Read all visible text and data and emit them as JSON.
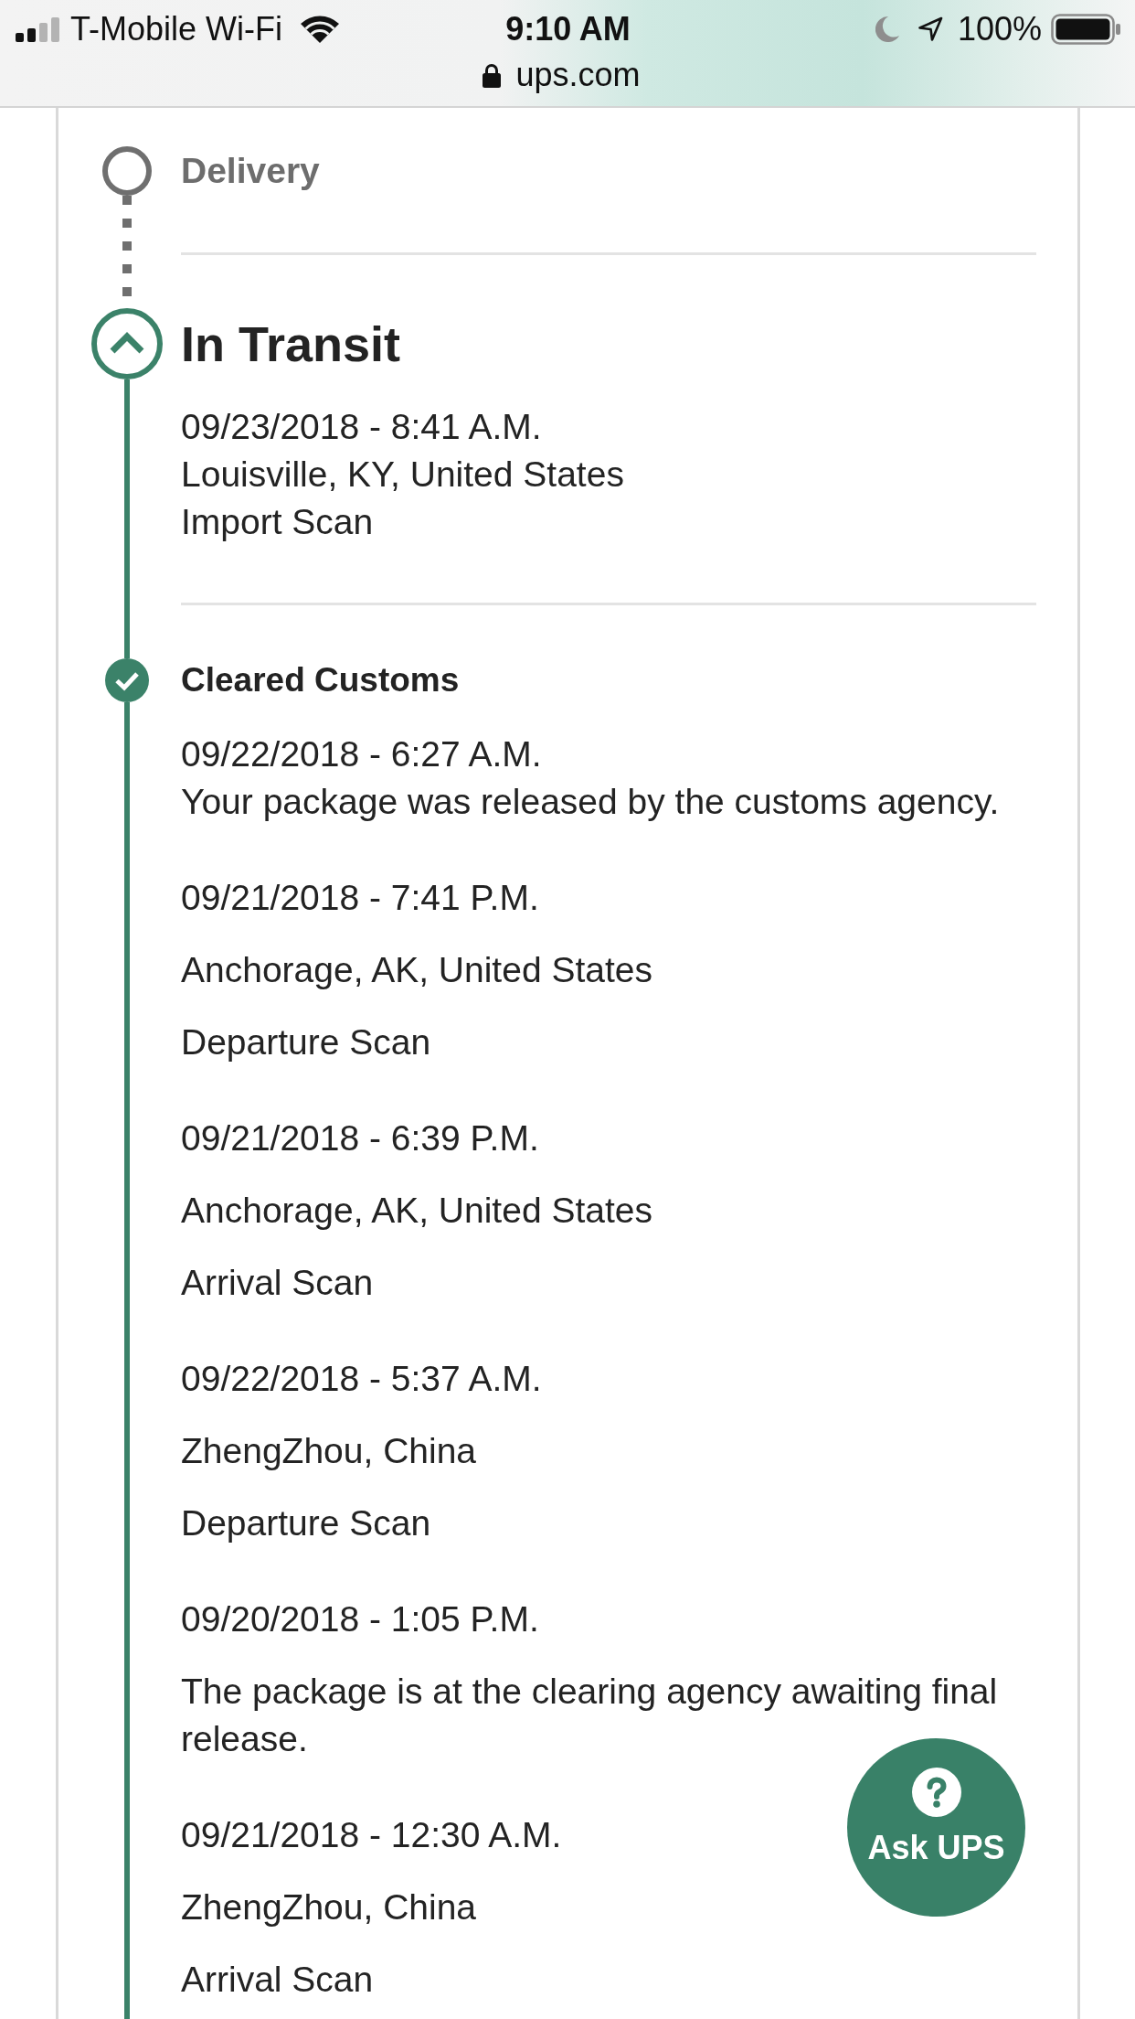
{
  "status_bar": {
    "carrier": "T-Mobile Wi-Fi",
    "time": "9:10 AM",
    "battery": "100%",
    "url": "ups.com"
  },
  "timeline": [
    {
      "name": "Delivery",
      "kind": "pending"
    },
    {
      "name": "In Transit",
      "kind": "current",
      "summary": {
        "date": "09/23/2018 - 8:41 A.M.",
        "location": "Louisville, KY, United States",
        "description": "Import Scan"
      }
    },
    {
      "name": "Cleared Customs",
      "kind": "complete",
      "summary": {
        "date": "09/22/2018 - 6:27 A.M.",
        "description": "Your package was released by the customs agency."
      },
      "activities": [
        {
          "date": "09/21/2018 - 7:41 P.M.",
          "location": "Anchorage, AK, United States",
          "description": "Departure Scan"
        },
        {
          "date": "09/21/2018 - 6:39 P.M.",
          "location": "Anchorage, AK, United States",
          "description": "Arrival Scan"
        },
        {
          "date": "09/22/2018 - 5:37 A.M.",
          "location": "ZhengZhou, China",
          "description": "Departure Scan"
        },
        {
          "date": "09/20/2018 - 1:05 P.M.",
          "description": "The package is at the clearing agency awaiting final release."
        },
        {
          "date": "09/21/2018 - 12:30 A.M.",
          "location": "ZhengZhou, China",
          "description": "Arrival Scan"
        }
      ]
    }
  ],
  "ask_button": {
    "label": "Ask UPS"
  }
}
